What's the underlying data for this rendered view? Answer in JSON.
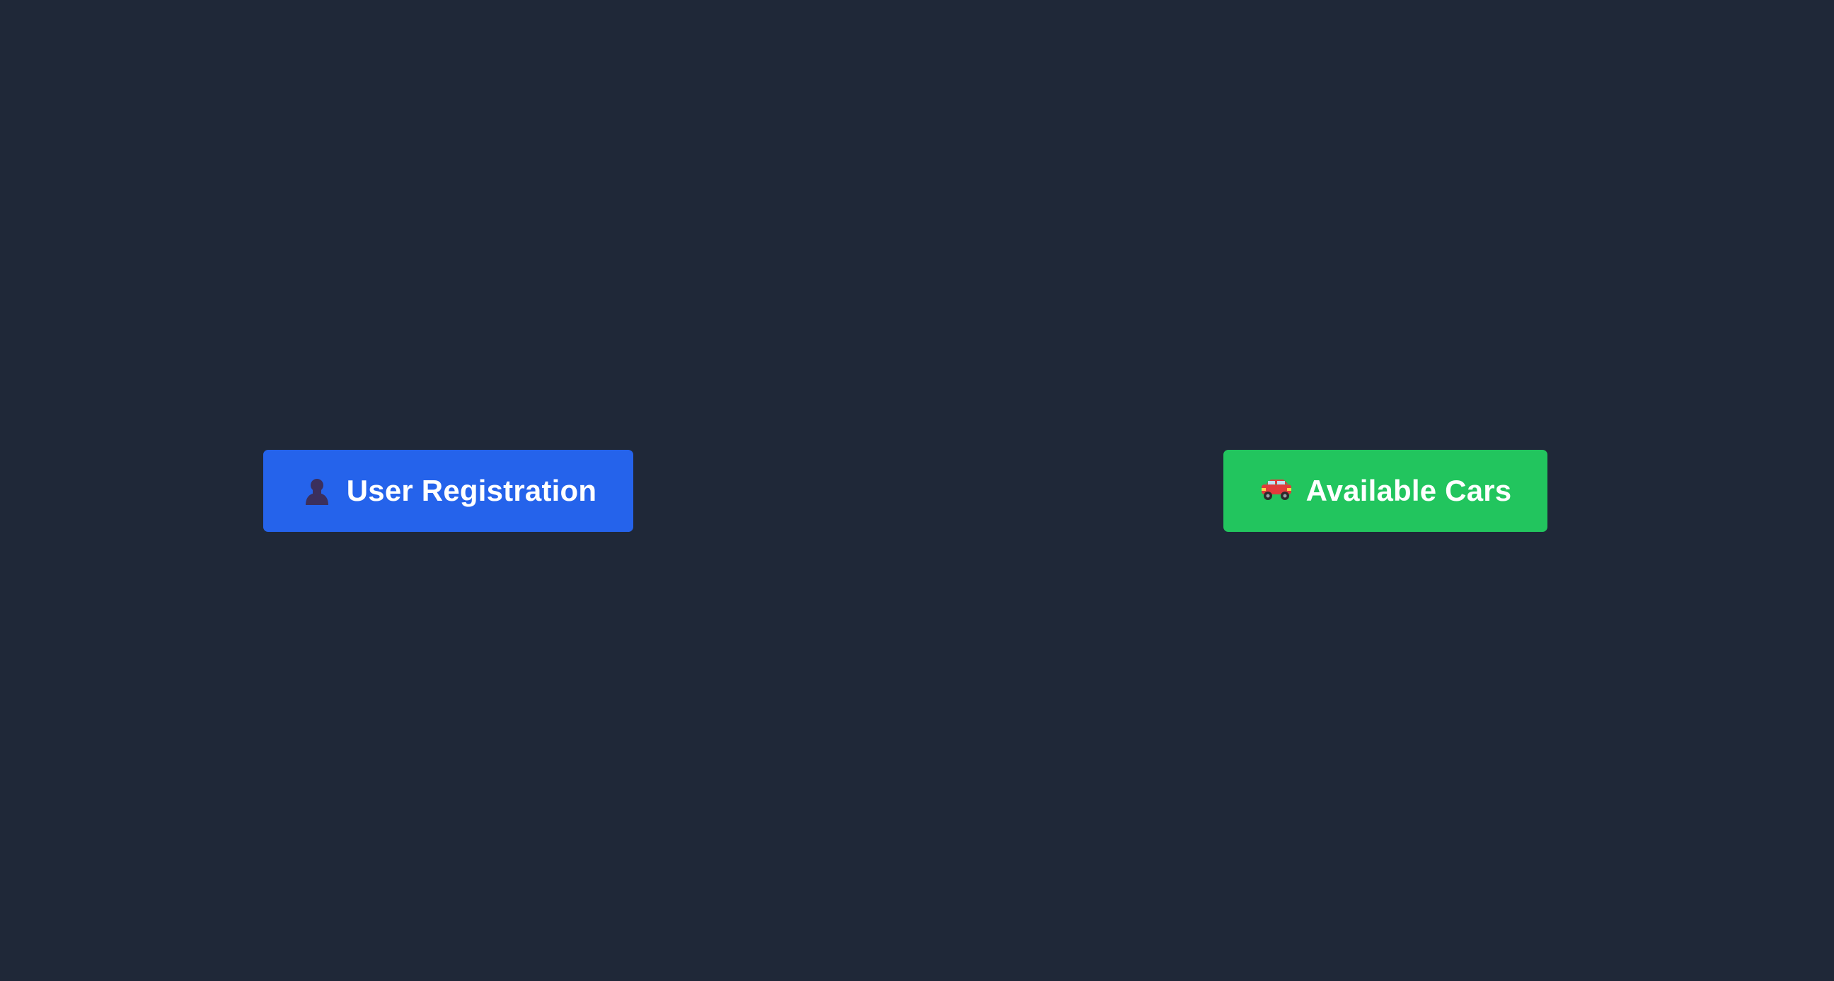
{
  "page": {
    "background": "#1f2838"
  },
  "buttons": {
    "register": {
      "label": "User Registration",
      "icon": "bust-in-silhouette-icon",
      "color": "#2563eb"
    },
    "cars": {
      "label": "Available Cars",
      "icon": "red-car-icon",
      "color": "#22c55e"
    }
  }
}
